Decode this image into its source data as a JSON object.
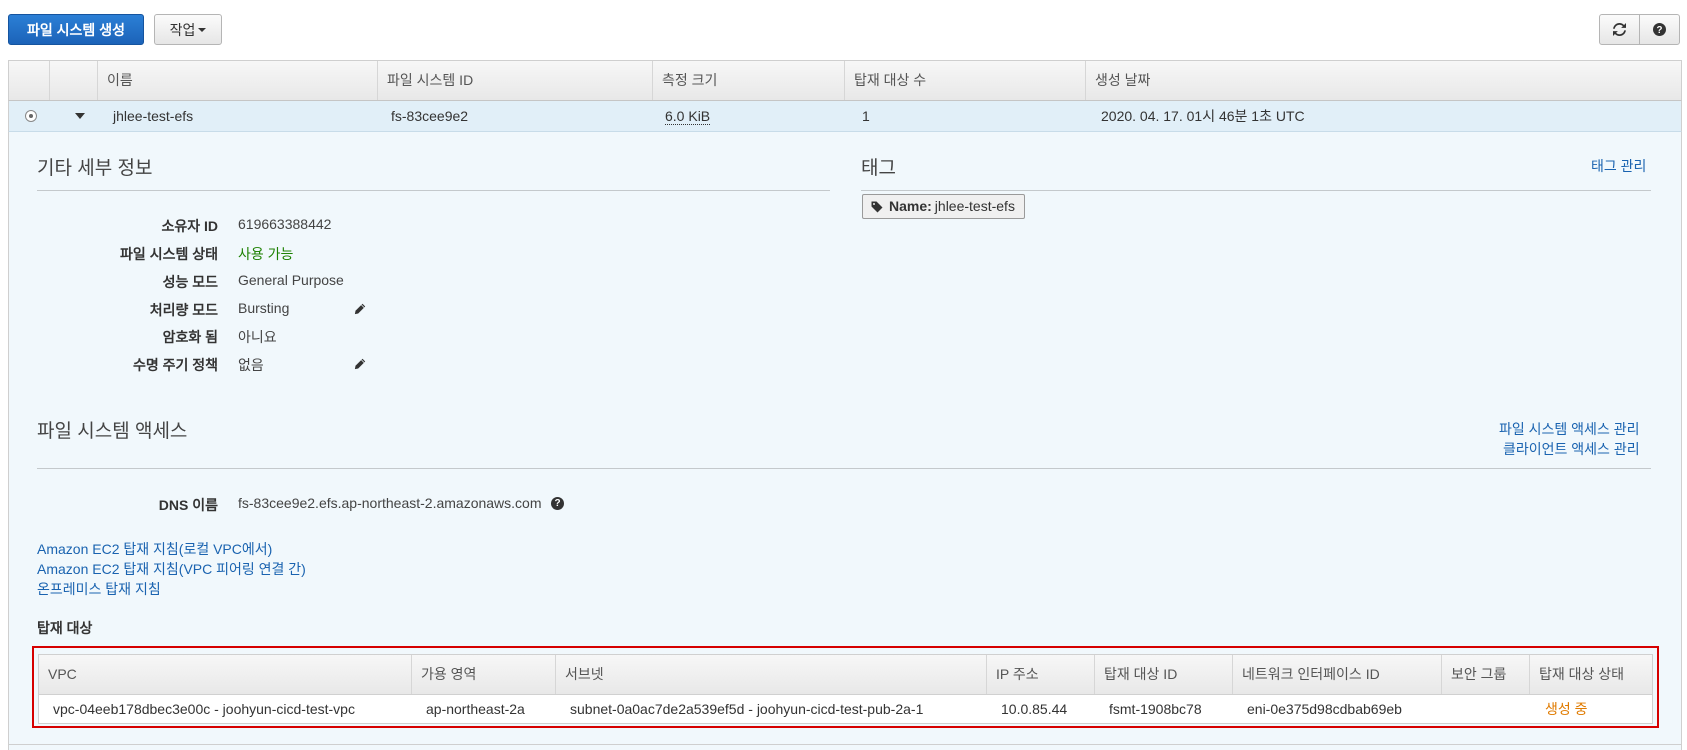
{
  "toolbar": {
    "create_label": "파일 시스템 생성",
    "actions_label": "작업",
    "refresh_icon": "refresh-icon",
    "help_icon": "question-icon"
  },
  "table": {
    "headers": [
      "이름",
      "파일 시스템 ID",
      "측정 크기",
      "탑재 대상 수",
      "생성 날짜"
    ],
    "row": {
      "name": "jhlee-test-efs",
      "fs_id": "fs-83cee9e2",
      "size": "6.0 KiB",
      "mount_count": "1",
      "created": "2020. 04. 17. 01시 46분 1초 UTC"
    }
  },
  "details": {
    "title": "기타 세부 정보",
    "items": [
      {
        "label": "소유자 ID",
        "value": "619663388442"
      },
      {
        "label": "파일 시스템 상태",
        "value": "사용 가능"
      },
      {
        "label": "성능 모드",
        "value": "General Purpose"
      },
      {
        "label": "처리량 모드",
        "value": "Bursting"
      },
      {
        "label": "암호화 됨",
        "value": "아니요"
      },
      {
        "label": "수명 주기 정책",
        "value": "없음"
      }
    ],
    "status_color": "#1d8102"
  },
  "tags": {
    "title": "태그",
    "manage_link": "태그 관리",
    "chip_key": "Name:",
    "chip_value": "jhlee-test-efs"
  },
  "access": {
    "title": "파일 시스템 액세스",
    "manage_fs_access": "파일 시스템 액세스 관리",
    "manage_client_access": "클라이언트 액세스 관리",
    "dns_label": "DNS 이름",
    "dns_value": "fs-83cee9e2.efs.ap-northeast-2.amazonaws.com",
    "links": [
      "Amazon EC2 탑재 지침(로컬 VPC에서)",
      "Amazon EC2 탑재 지침(VPC 피어링 연결 간)",
      "온프레미스 탑재 지침"
    ]
  },
  "mount_targets": {
    "title": "탑재 대상",
    "headers": [
      "VPC",
      "가용 영역",
      "서브넷",
      "IP 주소",
      "탑재 대상 ID",
      "네트워크 인터페이스 ID",
      "보안 그룹",
      "탑재 대상 상태"
    ],
    "row": {
      "vpc": "vpc-04eeb178dbec3e00c - joohyun-cicd-test-vpc",
      "az": "ap-northeast-2a",
      "subnet": "subnet-0a0ac7de2a539ef5d - joohyun-cicd-test-pub-2a-1",
      "ip": "10.0.85.44",
      "mount_id": "fsmt-1908bc78",
      "eni": "eni-0e375d98cdbab69eb",
      "sg": "",
      "status": "생성 중"
    },
    "status_color": "#e07b00",
    "highlight_color": "#d60000"
  }
}
